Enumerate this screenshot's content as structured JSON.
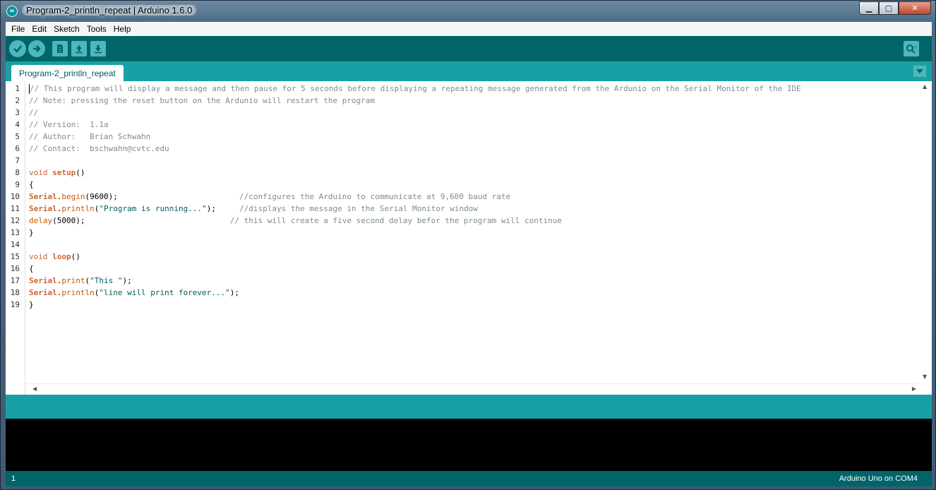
{
  "window": {
    "title": "Program-2_println_repeat | Arduino 1.6.0",
    "minimize_glyph": "▁",
    "maximize_glyph": "▢",
    "close_glyph": "✕"
  },
  "menu": [
    "File",
    "Edit",
    "Sketch",
    "Tools",
    "Help"
  ],
  "toolbar": {
    "buttons": [
      "verify-icon",
      "upload-icon",
      "new-icon",
      "open-icon",
      "save-icon",
      "serial-monitor-icon"
    ]
  },
  "tabs": [
    {
      "label": "Program-2_println_repeat"
    }
  ],
  "editor": {
    "line_numbers": [
      "1",
      "2",
      "3",
      "4",
      "5",
      "6",
      "7",
      "8",
      "9",
      "10",
      "11",
      "12",
      "13",
      "14",
      "15",
      "16",
      "17",
      "18",
      "19"
    ]
  },
  "code": {
    "l1": "// This program will display a message and then pause for 5 seconds before displaying a repeating message generated from the Ardunio on the Serial Monitor of the IDE",
    "l2": "// Note: pressing the reset button on the Ardunio will restart the program",
    "l3": "//",
    "l4": "// Version:  1.1a",
    "l5": "// Author:   Brian Schwahn",
    "l6": "// Contact:  bschwahn@cvtc.edu",
    "l8a": "void",
    "l8b": "setup",
    "l8c": "()",
    "l9": "{",
    "l10a": "Serial",
    "l10b": ".",
    "l10c": "begin",
    "l10d": "(9600);",
    "l10pad": "                          ",
    "l10e": "//configures the Arduino to communicate at 9,600 baud rate",
    "l11a": "Serial",
    "l11b": ".",
    "l11c": "println",
    "l11d": "(",
    "l11e": "\"Program is running...\"",
    "l11f": ");",
    "l11pad": "     ",
    "l11g": "//displays the message in the Serial Monitor window",
    "l12a": "delay",
    "l12b": "(5000);",
    "l12pad": "                               ",
    "l12c": "// this will create a five second delay befor the program will continue",
    "l13": "}",
    "l15a": "void",
    "l15b": "loop",
    "l15c": "()",
    "l16": "{",
    "l17a": "Serial",
    "l17b": ".",
    "l17c": "print",
    "l17d": "(",
    "l17e": "\"This \"",
    "l17f": ");",
    "l18a": "Serial",
    "l18b": ".",
    "l18c": "println",
    "l18d": "(",
    "l18e": "\"line will print forever...\"",
    "l18f": ");",
    "l19": "}"
  },
  "footer": {
    "line_number": "1",
    "board": "Arduino Uno on COM4"
  },
  "colors": {
    "toolbar": "#006468",
    "tabbar": "#17a1a5",
    "keyword": "#cc6633",
    "string": "#005c5f",
    "comment": "#7f8c8d"
  }
}
